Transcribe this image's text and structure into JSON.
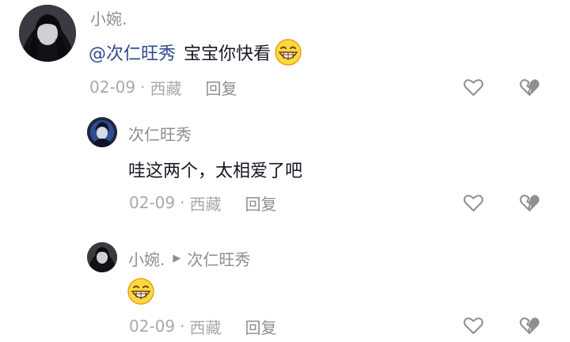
{
  "comments": [
    {
      "username": "小婉.",
      "mention": "@次仁旺秀",
      "text": "宝宝你快看",
      "emoji": "grinning-face",
      "date": "02-09",
      "location": "西藏",
      "reply_label": "回复"
    },
    {
      "username": "次仁旺秀",
      "text": "哇这两个，太相爱了吧",
      "date": "02-09",
      "location": "西藏",
      "reply_label": "回复"
    },
    {
      "username": "小婉.",
      "reply_to": "次仁旺秀",
      "emoji": "grinning-face",
      "date": "02-09",
      "location": "西藏",
      "reply_label": "回复"
    }
  ],
  "meta_separator": "·",
  "icons": {
    "like": "heart-outline-icon",
    "dislike": "broken-heart-icon"
  },
  "colors": {
    "mention": "#2e4c8c",
    "secondary_text": "#8e8e93",
    "body_text": "#161823"
  }
}
